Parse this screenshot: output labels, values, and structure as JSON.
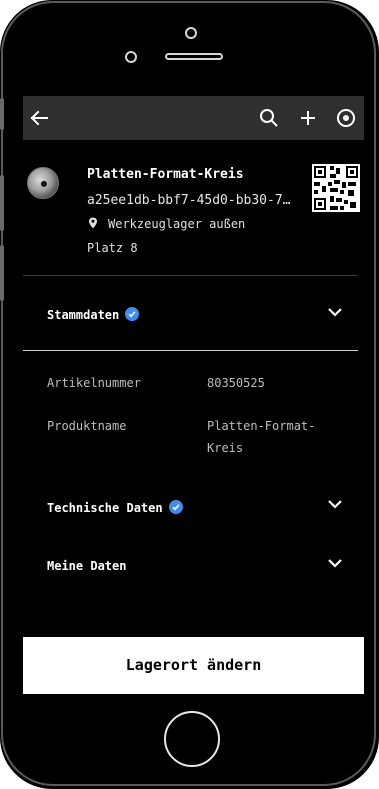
{
  "appbar": {
    "back_icon": "arrow-left-icon",
    "search_icon": "search-icon",
    "add_icon": "plus-icon",
    "target_icon": "target-icon"
  },
  "product": {
    "title": "Platten-Format-Kreis",
    "id": "a25ee1db-bbf7-45d0-bb30-7…",
    "location": "Werkzeuglager außen",
    "place": "Platz 8",
    "image_icon": "disc-icon",
    "qr_icon": "qr-code-icon"
  },
  "sections": {
    "stammdaten": {
      "label": "Stammdaten",
      "verified": true
    },
    "technische": {
      "label": "Technische Daten",
      "verified": true
    },
    "meine": {
      "label": "Meine Daten",
      "verified": false
    }
  },
  "stammdaten_fields": [
    {
      "label": "Artikelnummer",
      "value": "80350525"
    },
    {
      "label": "Produktname",
      "value_line1": "Platten-Format-",
      "value_line2": "Kreis"
    }
  ],
  "cta": {
    "label": "Lagerort ändern"
  },
  "colors": {
    "appbar": "#2f2f2f",
    "accent": "#3d8ef0",
    "background": "#000000",
    "cta_bg": "#ffffff"
  }
}
